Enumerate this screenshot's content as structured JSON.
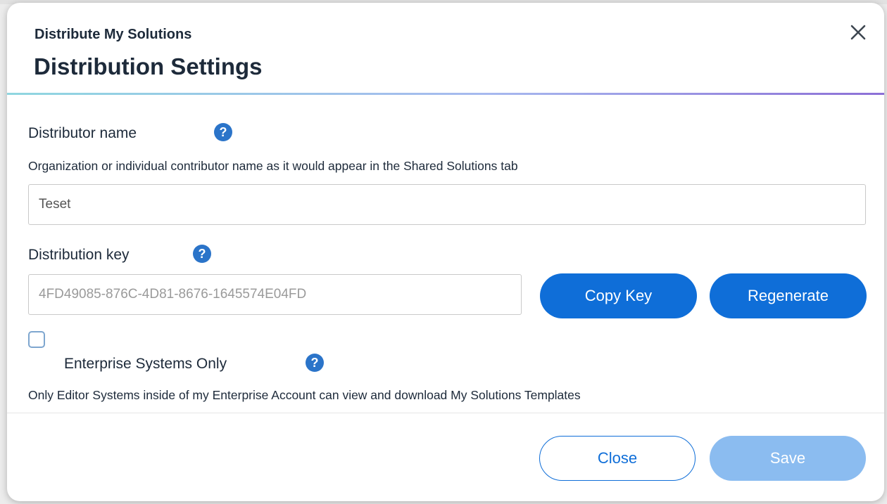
{
  "dialog": {
    "subtitle": "Distribute My Solutions",
    "title": "Distribution Settings",
    "close_icon": "close-x-icon"
  },
  "distributor": {
    "label": "Distributor name",
    "help_glyph": "?",
    "description": "Organization or individual contributor name as it would appear in the Shared Solutions tab",
    "value": "Teset"
  },
  "distribution_key": {
    "label": "Distribution key",
    "help_glyph": "?",
    "value": "4FD49085-876C-4D81-8676-1645574E04FD",
    "copy_label": "Copy Key",
    "regenerate_label": "Regenerate"
  },
  "enterprise": {
    "checked": false,
    "label": "Enterprise Systems Only",
    "help_glyph": "?",
    "description": "Only Editor Systems inside of my Enterprise Account can view and download My Solutions Templates"
  },
  "footer": {
    "close_label": "Close",
    "save_label": "Save"
  },
  "colors": {
    "primary": "#0f6ed8",
    "primary_disabled": "#8bbcf0",
    "help_icon": "#2b74c9",
    "text": "#1d2a3a"
  }
}
